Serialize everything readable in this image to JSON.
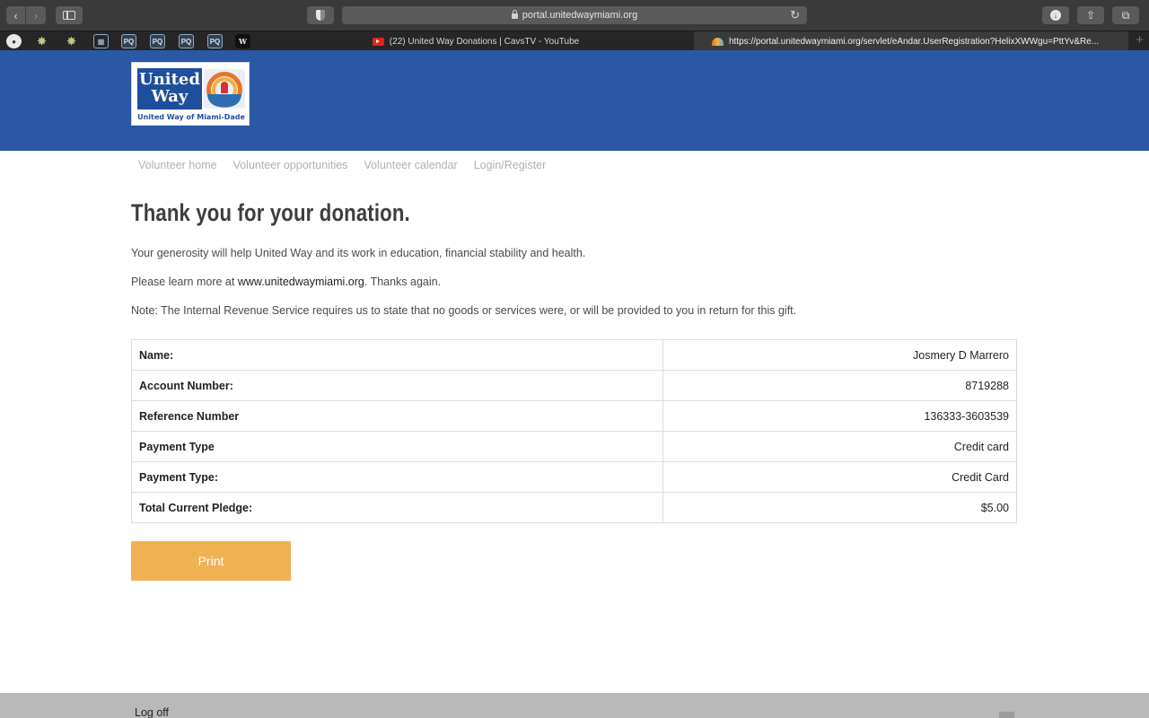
{
  "browser": {
    "address": "portal.unitedwaymiami.org",
    "tabs": [
      {
        "title": "(22) United Way Donations | CavsTV - YouTube"
      },
      {
        "title": "https://portal.unitedwaymiami.org/servlet/eAndar.UserRegistration?HelixXWWgu=PttYv&Re..."
      }
    ],
    "favorites": [
      "PQ",
      "PQ",
      "PQ",
      "PQ",
      "W"
    ]
  },
  "logo": {
    "word1": "United",
    "word2": "Way",
    "caption": "United Way of Miami-Dade"
  },
  "nav": [
    "Volunteer home",
    "Volunteer opportunities",
    "Volunteer calendar",
    "Login/Register"
  ],
  "page": {
    "title": "Thank you for your donation.",
    "para1": "Your generosity will help United Way and its work in education, financial stability and health.",
    "para2_prefix": "Please learn more at ",
    "para2_link": "www.unitedwaymiami.org",
    "para2_suffix": ". Thanks again.",
    "para3": "Note: The Internal Revenue Service requires us to state that no goods or services were, or will be provided to you in return for this gift."
  },
  "details": [
    {
      "label": "Name:",
      "value": "Josmery D Marrero"
    },
    {
      "label": "Account Number:",
      "value": "8719288"
    },
    {
      "label": "Reference Number",
      "value": "136333-3603539"
    },
    {
      "label": "Payment Type",
      "value": "Credit card"
    },
    {
      "label": "Payment Type:",
      "value": "Credit Card"
    },
    {
      "label": "Total Current Pledge:",
      "value": "$5.00"
    }
  ],
  "print_label": "Print",
  "footer": {
    "logoff": "Log off"
  },
  "colors": {
    "header_blue": "#2a58a5",
    "print_orange": "#f0b153"
  }
}
